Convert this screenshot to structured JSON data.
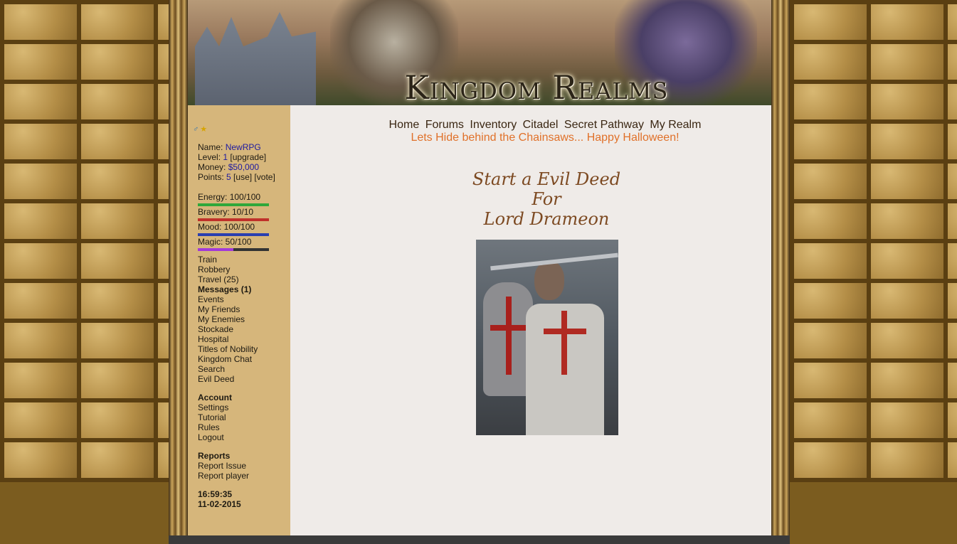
{
  "banner": {
    "title": "Kingdom Realms"
  },
  "sidebar": {
    "icons": [
      "male-icon",
      "star-icon"
    ],
    "stats": {
      "name_label": "Name:",
      "name_value": "NewRPG",
      "level_label": "Level:",
      "level_value": "1",
      "level_action": "upgrade",
      "money_label": "Money:",
      "money_value": "$50,000",
      "points_label": "Points:",
      "points_value": "5",
      "points_use": "use",
      "points_vote": "vote"
    },
    "bars": [
      {
        "label": "Energy: 100/100",
        "fraction": 1.0,
        "color": "#2fa83a"
      },
      {
        "label": "Bravery: 10/10",
        "fraction": 1.0,
        "color": "#c0302a"
      },
      {
        "label": "Mood: 100/100",
        "fraction": 1.0,
        "color": "#2a3fb0"
      },
      {
        "label": "Magic: 50/100",
        "fraction": 0.5,
        "color": "#a23ad8"
      }
    ],
    "menu": [
      "Train",
      "Robbery",
      "Travel (25)",
      "Messages (1)",
      "Events",
      "My Friends",
      "My Enemies",
      "Stockade",
      "Hospital",
      "Titles of Nobility",
      "Kingdom Chat",
      "Search",
      "Evil Deed"
    ],
    "account": {
      "heading": "Account",
      "items": [
        "Settings",
        "Tutorial",
        "Rules",
        "Logout"
      ]
    },
    "reports": {
      "heading": "Reports",
      "items": [
        "Report Issue",
        "Report player"
      ]
    },
    "clock": {
      "time": "16:59:35",
      "date": "11-02-2015"
    }
  },
  "nav": [
    "Home",
    "Forums",
    "Inventory",
    "Citadel",
    "Secret Pathway",
    "My Realm"
  ],
  "announcement": "Lets Hide behind the Chainsaws... Happy Halloween!",
  "deed": {
    "line1": "Start a Evil Deed",
    "line2": "For",
    "line3": "Lord Drameon"
  },
  "colors": {
    "sidebar_bg": "#d6b67b",
    "main_bg": "#efebe8",
    "link": "#1d1aa0",
    "announcement": "#e0712a"
  }
}
